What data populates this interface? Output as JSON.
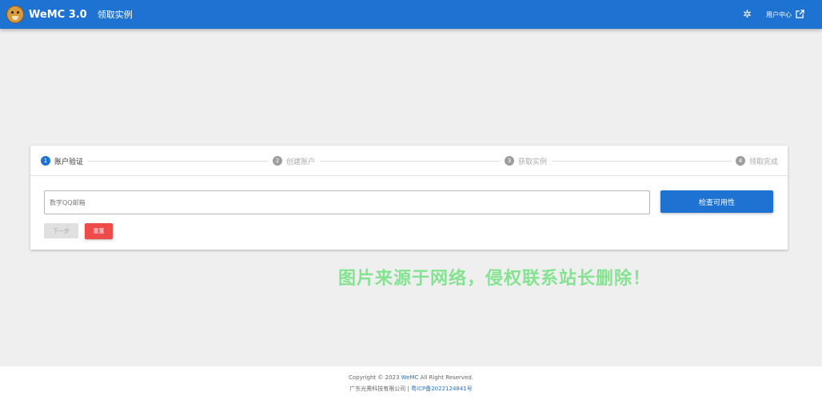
{
  "header": {
    "brand": "WeMC 3.0",
    "page_title": "领取实例",
    "user_center": "用户中心",
    "icons": {
      "settings": "gear-icon",
      "external": "external-link-icon",
      "logo": "dog-logo-icon"
    }
  },
  "stepper": {
    "steps": [
      {
        "num": "1",
        "label": "账户验证"
      },
      {
        "num": "2",
        "label": "创建账户"
      },
      {
        "num": "3",
        "label": "获取实例"
      },
      {
        "num": "4",
        "label": "领取完成"
      }
    ],
    "active_step": 1
  },
  "form": {
    "placeholder": "数字QQ邮箱",
    "value": "",
    "check_button": "检查可用性",
    "next_button": "下一步",
    "reset_button": "重置"
  },
  "watermark": "图片来源于网络，侵权联系站长删除！",
  "footer": {
    "copyright_prefix": "Copyright © 2023 ",
    "copyright_brand": "WeMC",
    "copyright_suffix": " All Right Reserved.",
    "company": "广东光需科技有限公司 | ",
    "icp": "粤ICP备2022124841号"
  },
  "colors": {
    "primary": "#1e73d2",
    "danger": "#f04b4b",
    "watermark": "#7fe38c"
  }
}
